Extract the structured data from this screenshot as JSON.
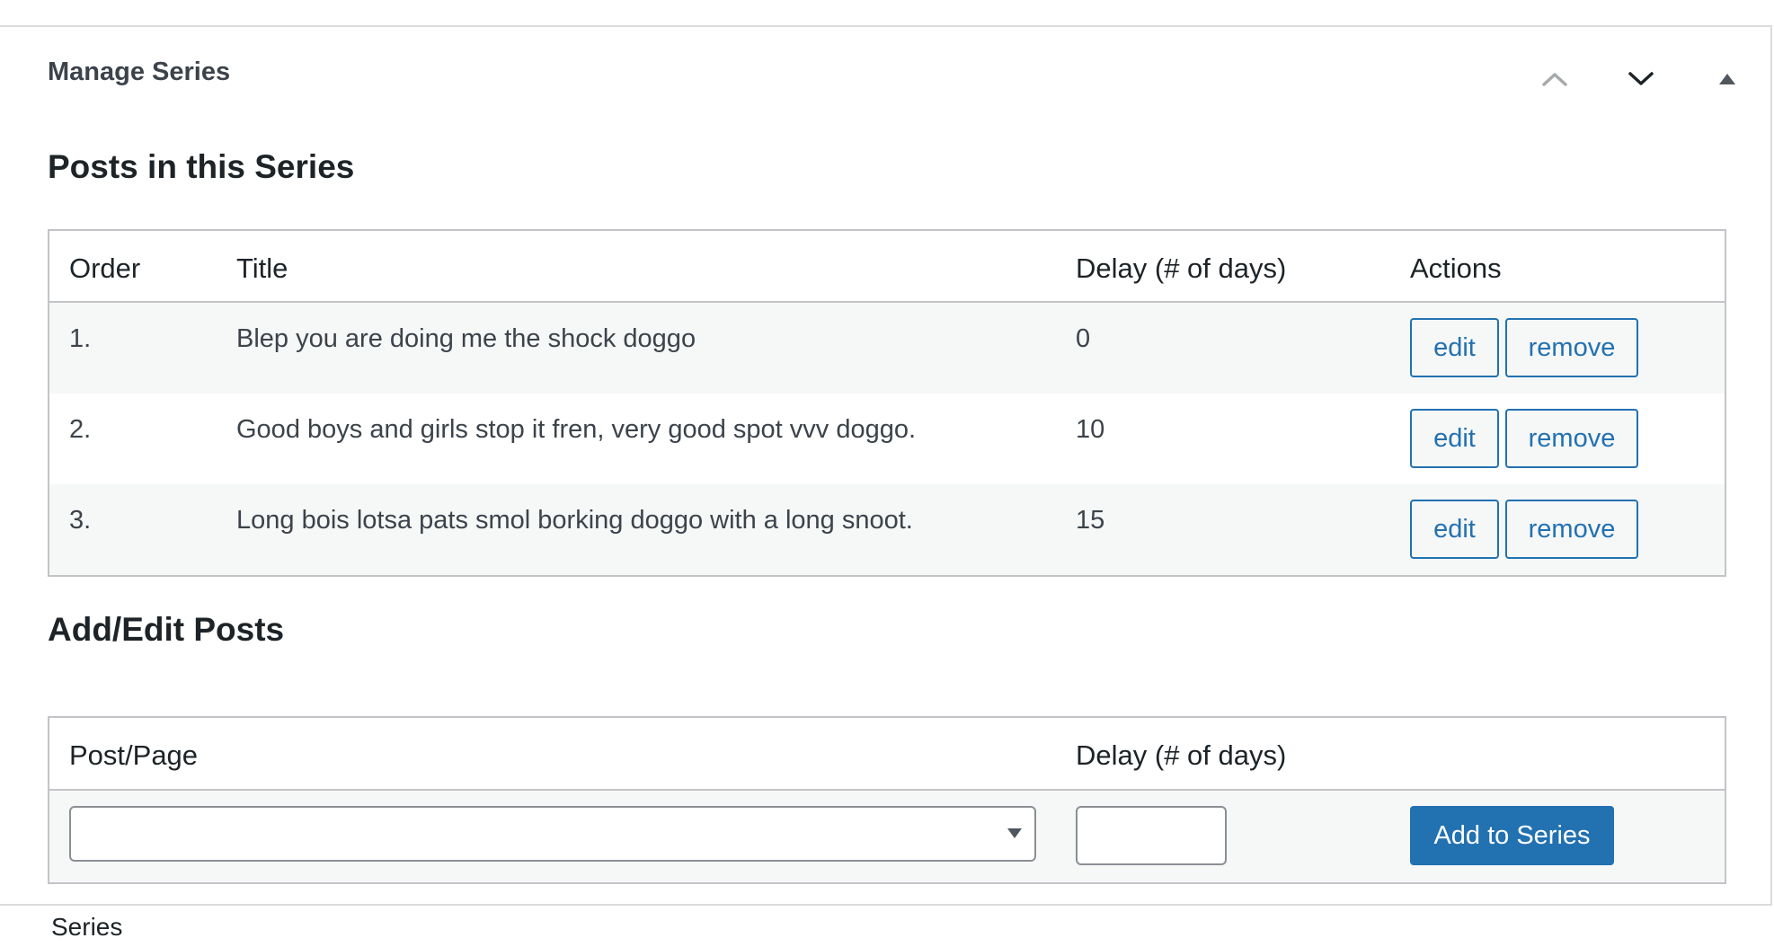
{
  "metabox": {
    "title": "Manage Series",
    "controls": {
      "move_up": "chevron-up-icon",
      "move_down": "chevron-down-icon",
      "toggle": "triangle-up-icon"
    }
  },
  "posts_section": {
    "heading": "Posts in this Series",
    "columns": {
      "order": "Order",
      "title": "Title",
      "delay": "Delay (# of days)",
      "actions": "Actions"
    },
    "rows": [
      {
        "order": "1.",
        "title": "Blep you are doing me the shock doggo",
        "delay": "0",
        "edit_label": "edit",
        "remove_label": "remove"
      },
      {
        "order": "2.",
        "title": "Good boys and girls stop it fren, very good spot vvv doggo.",
        "delay": "10",
        "edit_label": "edit",
        "remove_label": "remove"
      },
      {
        "order": "3.",
        "title": "Long bois lotsa pats smol borking doggo with a long snoot.",
        "delay": "15",
        "edit_label": "edit",
        "remove_label": "remove"
      }
    ]
  },
  "add_section": {
    "heading": "Add/Edit Posts",
    "columns": {
      "post": "Post/Page",
      "delay": "Delay (# of days)"
    },
    "post_select_value": "",
    "delay_value": "",
    "submit_label": "Add to Series"
  },
  "next_box": {
    "label": "Series"
  },
  "colors": {
    "accent": "#2271b1",
    "border": "#c3c4c7",
    "row_alt": "#f6f7f7",
    "text": "#1d2327"
  }
}
